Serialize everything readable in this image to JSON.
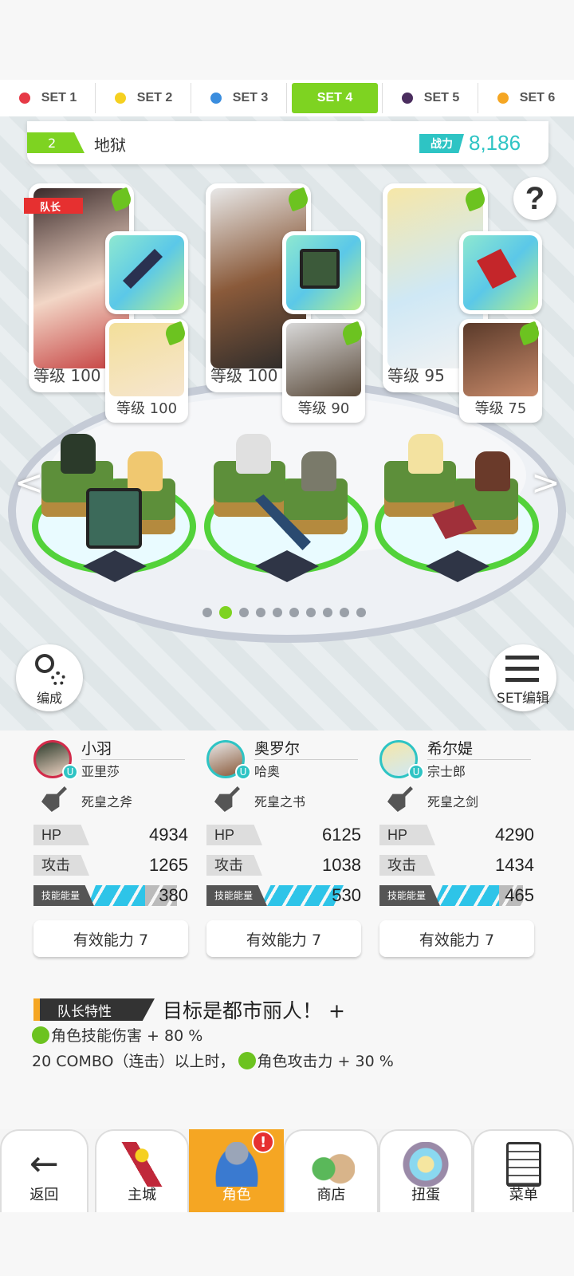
{
  "set_tabs": [
    {
      "label": "SET 1",
      "color": "#e63946"
    },
    {
      "label": "SET 2",
      "color": "#f5d020"
    },
    {
      "label": "SET 3",
      "color": "#3a8dde"
    },
    {
      "label": "SET 4",
      "color": "#7ed321",
      "active": true
    },
    {
      "label": "SET 5",
      "color": "#4a2d5e"
    },
    {
      "label": "SET 6",
      "color": "#f5a623"
    }
  ],
  "team": {
    "number": "2",
    "name": "地狱",
    "power_label": "战力",
    "power": "8,186"
  },
  "leader_badge": "队长",
  "help_label": "?",
  "portraits": [
    {
      "level": "等级 100",
      "sub_level": "等级 100"
    },
    {
      "level": "等级 100",
      "sub_level": "等级 90"
    },
    {
      "level": "等级 95",
      "sub_level": "等级 75"
    }
  ],
  "nav_arrows": {
    "left": "<",
    "right": ">"
  },
  "page_dots": {
    "count": 10,
    "active_index": 1
  },
  "formation_button": "编成",
  "set_edit_button": "SET编辑",
  "characters": [
    {
      "name": "小羽",
      "sub_name": "亚里莎",
      "weapon": "死皇之斧",
      "hp_label": "HP",
      "hp": "4934",
      "atk_label": "攻击",
      "atk": "1265",
      "energy_label": "技能能量",
      "energy": "380",
      "ability": "有效能力 7"
    },
    {
      "name": "奥罗尔",
      "sub_name": "哈奥",
      "weapon": "死皇之书",
      "hp_label": "HP",
      "hp": "6125",
      "atk_label": "攻击",
      "atk": "1038",
      "energy_label": "技能能量",
      "energy": "530",
      "ability": "有效能力 7"
    },
    {
      "name": "希尔媞",
      "sub_name": "宗士郎",
      "weapon": "死皇之剑",
      "hp_label": "HP",
      "hp": "4290",
      "atk_label": "攻击",
      "atk": "1434",
      "energy_label": "技能能量",
      "energy": "465",
      "ability": "有效能力 7"
    }
  ],
  "leader_trait": {
    "tag": "队长特性",
    "title": "目标是都市丽人！ +",
    "effect1": "角色技能伤害 + 80 %",
    "effect2_prefix": "20 COMBO（连击）以上时，",
    "effect2_suffix": "角色攻击力 + 30 %"
  },
  "bottom_nav": [
    {
      "label": "返回",
      "icon": "back-arrow-icon"
    },
    {
      "label": "主城",
      "icon": "castle-icon"
    },
    {
      "label": "角色",
      "icon": "character-icon",
      "active": true,
      "alert": "!"
    },
    {
      "label": "商店",
      "icon": "shop-icon"
    },
    {
      "label": "扭蛋",
      "icon": "gacha-icon"
    },
    {
      "label": "菜单",
      "icon": "menu-icon"
    }
  ]
}
